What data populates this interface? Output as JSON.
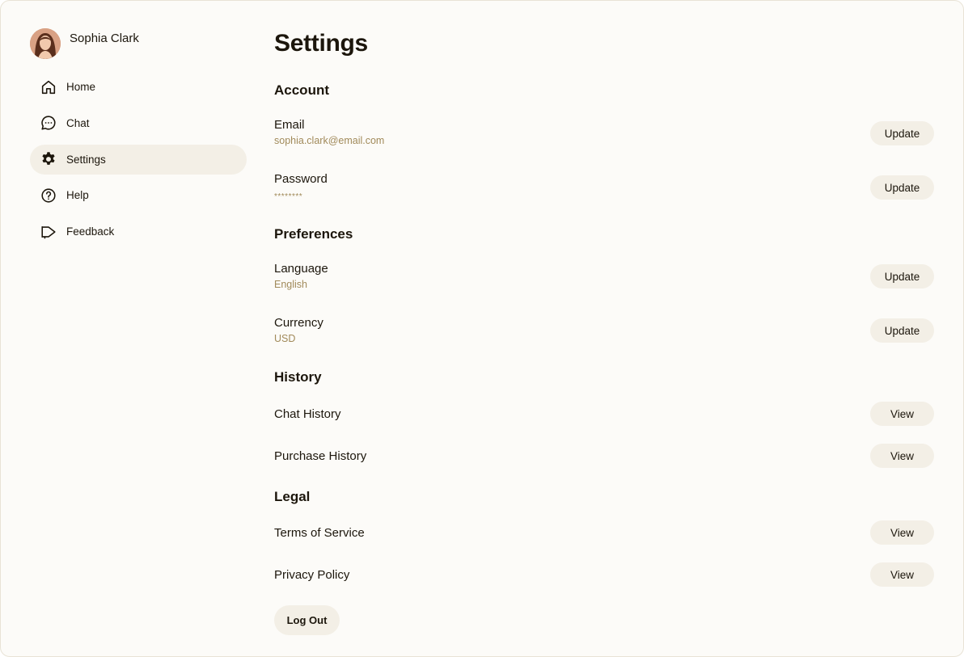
{
  "user": {
    "name": "Sophia Clark"
  },
  "nav": {
    "items": [
      {
        "label": "Home",
        "icon": "home-icon"
      },
      {
        "label": "Chat",
        "icon": "chat-icon"
      },
      {
        "label": "Settings",
        "icon": "gear-icon",
        "active": true
      },
      {
        "label": "Help",
        "icon": "help-icon"
      },
      {
        "label": "Feedback",
        "icon": "megaphone-icon"
      }
    ]
  },
  "page": {
    "title": "Settings"
  },
  "account": {
    "title": "Account",
    "email": {
      "label": "Email",
      "value": "sophia.clark@email.com",
      "button": "Update"
    },
    "password": {
      "label": "Password",
      "value": "********",
      "button": "Update"
    }
  },
  "preferences": {
    "title": "Preferences",
    "language": {
      "label": "Language",
      "value": "English",
      "button": "Update"
    },
    "currency": {
      "label": "Currency",
      "value": "USD",
      "button": "Update"
    }
  },
  "history": {
    "title": "History",
    "chat": {
      "label": "Chat History",
      "button": "View"
    },
    "purchase": {
      "label": "Purchase History",
      "button": "View"
    }
  },
  "legal": {
    "title": "Legal",
    "terms": {
      "label": "Terms of Service",
      "button": "View"
    },
    "privacy": {
      "label": "Privacy Policy",
      "button": "View"
    }
  },
  "logout_label": "Log Out",
  "colors": {
    "accent_text": "#a18a5a",
    "pill_bg": "#f3efe6",
    "background": "#fcfbf8",
    "text": "#1c160c"
  }
}
